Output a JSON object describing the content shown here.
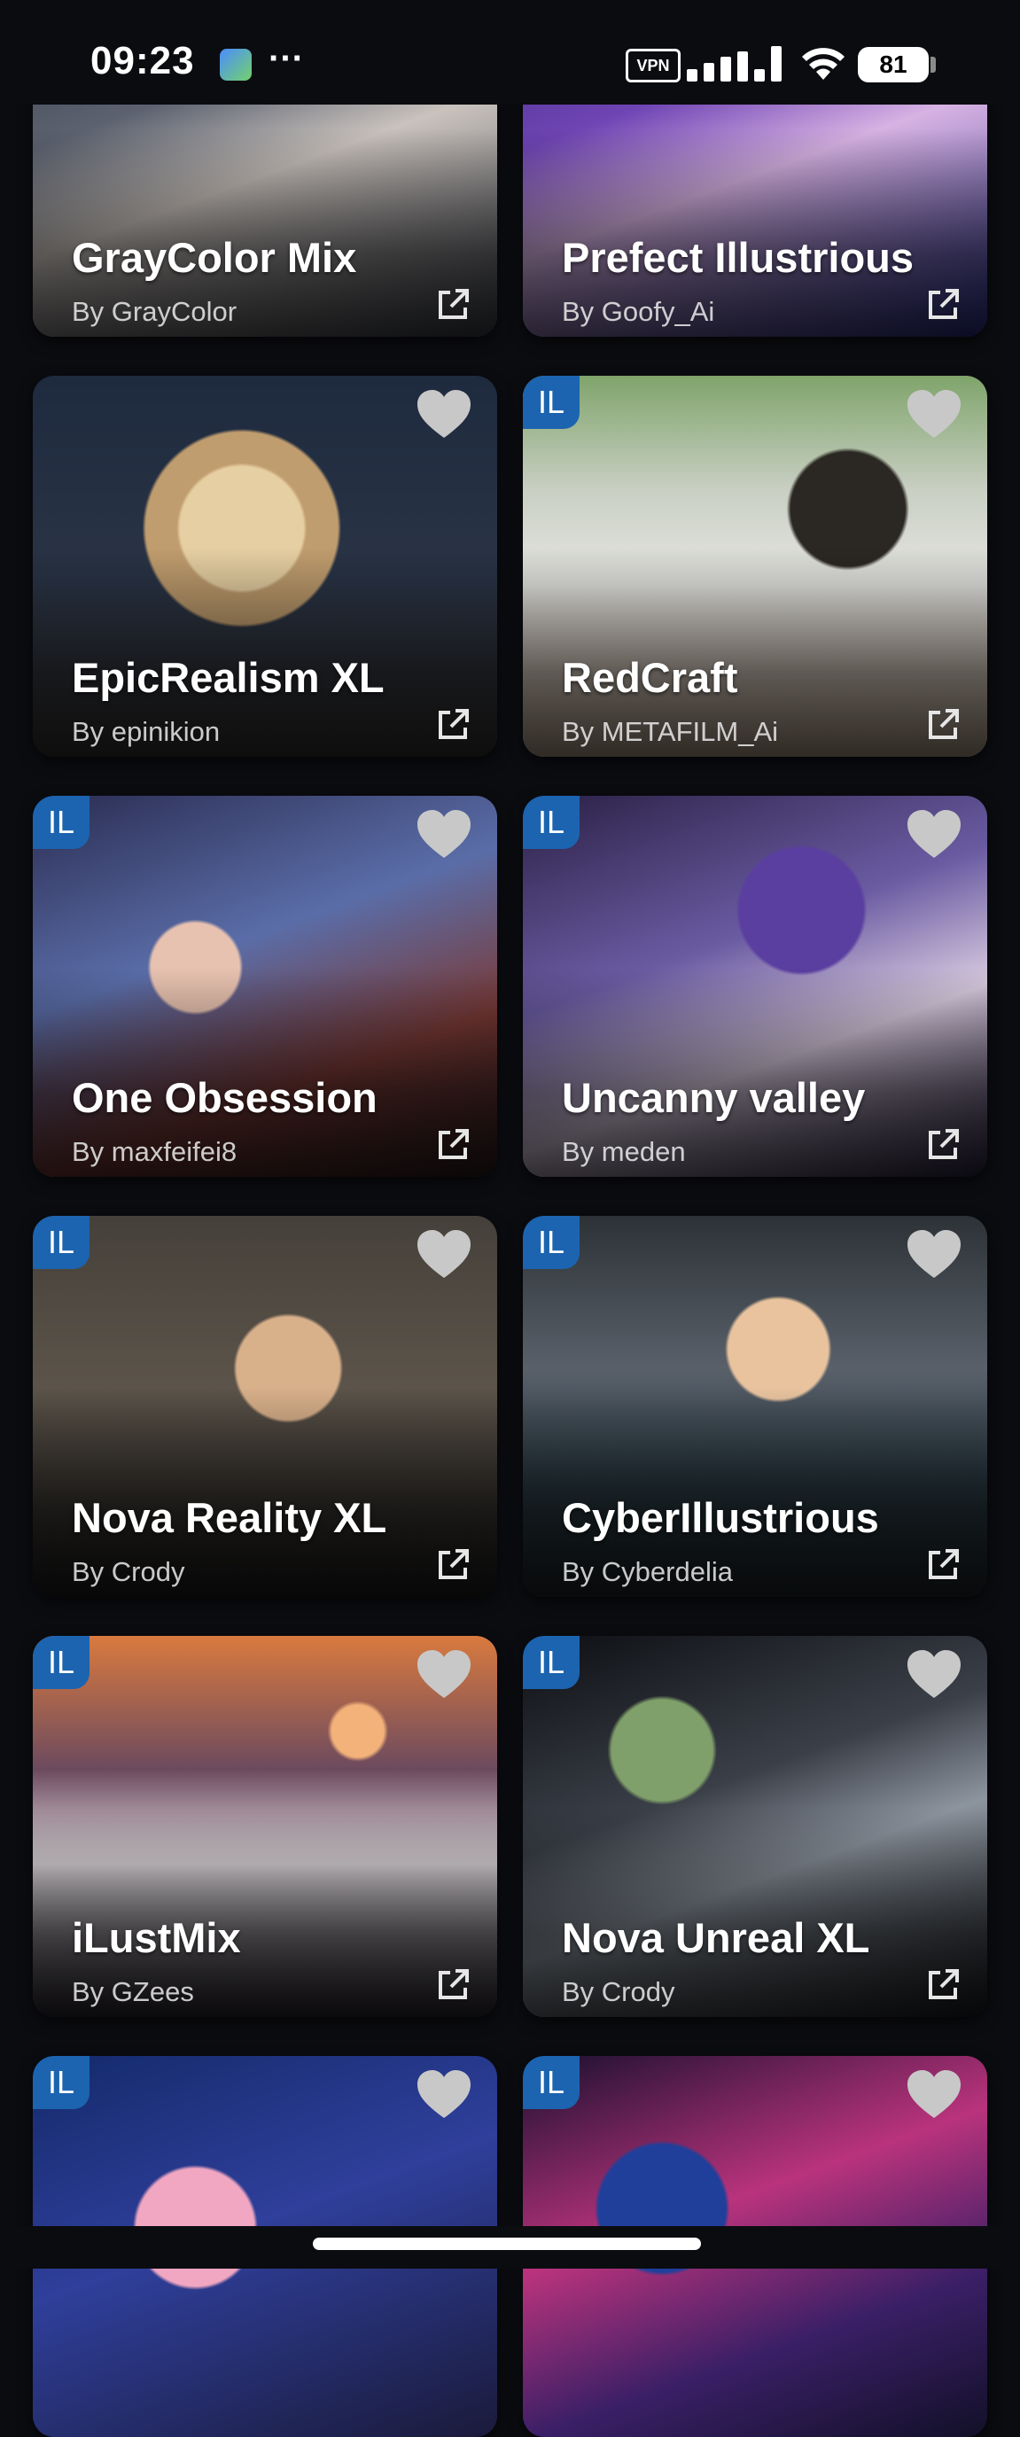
{
  "status_bar": {
    "time": "09:23",
    "more": "···",
    "vpn": "VPN",
    "battery": "81"
  },
  "colors": {
    "background": "#0b0c10",
    "badge": "#1c64b0",
    "heart": "#c8c8c8"
  },
  "icons": {
    "heart": "heart-icon",
    "open": "external-link-icon",
    "signal": "signal-icon",
    "wifi": "wifi-icon",
    "battery": "battery-icon"
  },
  "models": [
    {
      "title": "GrayColor Mix",
      "author": "By GrayColor",
      "badge": ""
    },
    {
      "title": "Prefect Illustrious",
      "author": "By Goofy_Ai",
      "badge": ""
    },
    {
      "title": "EpicRealism XL",
      "author": "By epinikion",
      "badge": ""
    },
    {
      "title": "RedCraft",
      "author": "By METAFILM_Ai",
      "badge": "IL"
    },
    {
      "title": "One Obsession",
      "author": "By maxfeifei8",
      "badge": "IL"
    },
    {
      "title": "Uncanny valley",
      "author": "By meden",
      "badge": "IL"
    },
    {
      "title": "Nova Reality XL",
      "author": "By Crody",
      "badge": "IL"
    },
    {
      "title": "CyberIllustrious",
      "author": "By Cyberdelia",
      "badge": "IL"
    },
    {
      "title": "iLustMix",
      "author": "By GZees",
      "badge": "IL"
    },
    {
      "title": "Nova Unreal XL",
      "author": "By Crody",
      "badge": "IL"
    },
    {
      "title": "",
      "author": "",
      "badge": "IL"
    },
    {
      "title": "",
      "author": "",
      "badge": "IL"
    }
  ]
}
